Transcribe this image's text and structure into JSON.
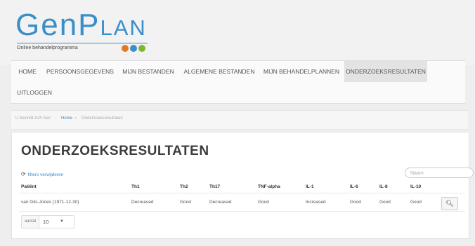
{
  "brand": {
    "logo_prefix": "Gen",
    "logo_suffix": "Plan",
    "tagline": "Online behandelprogramma",
    "dot_colors": [
      "#e07a24",
      "#3a8fc9",
      "#7cb82f"
    ]
  },
  "nav": {
    "items": [
      {
        "label": "HOME"
      },
      {
        "label": "PERSOONSGEGEVENS"
      },
      {
        "label": "MIJN BESTANDEN"
      },
      {
        "label": "ALGEMENE BESTANDEN"
      },
      {
        "label": "MIJN BEHANDELPLANNEN"
      },
      {
        "label": "ONDERZOEKSRESULTATEN",
        "active": true
      },
      {
        "label": "UITLOGGEN"
      }
    ]
  },
  "breadcrumb": {
    "prefix": "U bevindt zich hier:",
    "home": "Home",
    "separator": "›",
    "current": "Onderzoeksresultaten"
  },
  "page": {
    "title": "ONDERZOEKSRESULTATEN",
    "clear_filters": "filters verwijderen",
    "search_placeholder": "Naam"
  },
  "table": {
    "headers": [
      "Patiënt",
      "Th1",
      "Th2",
      "Th17",
      "TNF-alpha",
      "IL-1",
      "IL-6",
      "IL-8",
      "IL-10"
    ],
    "rows": [
      [
        "van Gils-Jones (1971-12-30)",
        "Decreased",
        "Good",
        "Decreased",
        "Good",
        "Increased",
        "Good",
        "Good",
        "Good"
      ]
    ]
  },
  "pager": {
    "label": "aantal",
    "value": "10"
  },
  "colors": {
    "accent": "#3a8fc9",
    "active_tab_bg": "#e3e3e3"
  }
}
